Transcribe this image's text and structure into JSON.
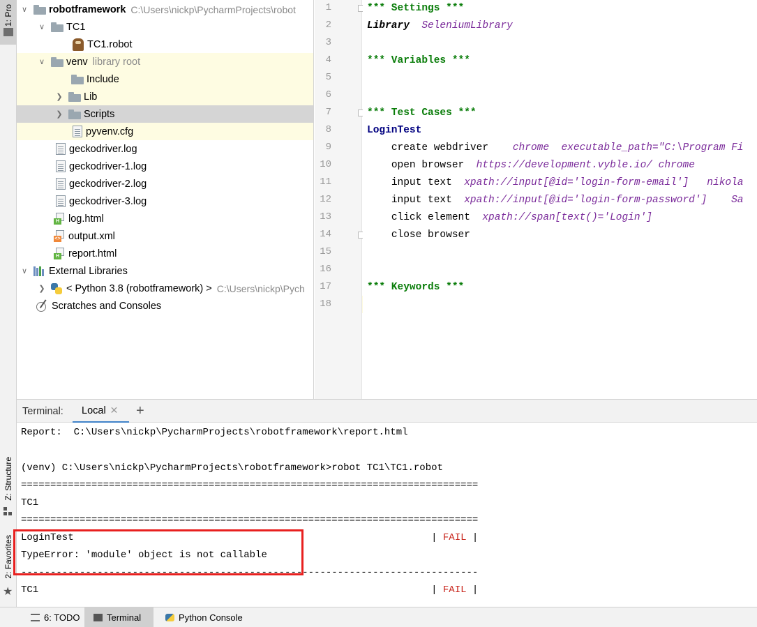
{
  "left_strip": {
    "tab_project": "1: Pro",
    "tab_structure": "Z: Structure",
    "tab_favorites": "2: Favorites"
  },
  "project_tree": [
    {
      "label": "robotframework",
      "meta": "C:\\Users\\nickp\\PycharmProjects\\robot"
    },
    {
      "label": "TC1"
    },
    {
      "label": "TC1.robot"
    },
    {
      "label": "venv",
      "meta": "library root"
    },
    {
      "label": "Include"
    },
    {
      "label": "Lib"
    },
    {
      "label": "Scripts"
    },
    {
      "label": "pyvenv.cfg"
    },
    {
      "label": "geckodriver.log"
    },
    {
      "label": "geckodriver-1.log"
    },
    {
      "label": "geckodriver-2.log"
    },
    {
      "label": "geckodriver-3.log"
    },
    {
      "label": "log.html"
    },
    {
      "label": "output.xml"
    },
    {
      "label": "report.html"
    },
    {
      "label": "External Libraries"
    },
    {
      "label": "< Python 3.8 (robotframework) >",
      "meta": "C:\\Users\\nickp\\Pych"
    },
    {
      "label": "Scratches and Consoles"
    }
  ],
  "editor": {
    "line_numbers": [
      "1",
      "2",
      "3",
      "4",
      "5",
      "6",
      "7",
      "8",
      "9",
      "10",
      "11",
      "12",
      "13",
      "14",
      "15",
      "16",
      "17",
      "18"
    ],
    "l1": "*** Settings ***",
    "l2_kw": "Library",
    "l2_arg": "SeleniumLibrary",
    "l4": "*** Variables ***",
    "l7": "*** Test Cases ***",
    "l8": "LoginTest",
    "l9_kw": "create webdriver",
    "l9_arg": "chrome  executable_path=\"C:\\Program Fi",
    "l10_kw": "open browser",
    "l10_arg": "https://development.vyble.io/ chrome",
    "l11_kw": "input text",
    "l11_arg": "xpath://input[@id='login-form-email']   nikola",
    "l12_kw": "input text",
    "l12_arg": "xpath://input[@id='login-form-password']    Sa",
    "l13_kw": "click element",
    "l13_arg": "xpath://span[text()='Login']",
    "l14_kw": "close browser",
    "l17": "*** Keywords ***"
  },
  "terminal": {
    "label": "Terminal:",
    "tab": "Local",
    "add": "+",
    "lines": {
      "report": "Report:  C:\\Users\\nickp\\PycharmProjects\\robotframework\\report.html",
      "command": "(venv) C:\\Users\\nickp\\PycharmProjects\\robotframework>robot TC1\\TC1.robot",
      "sep1": "==============================================================================",
      "tc1": "TC1",
      "sep2": "==============================================================================",
      "login_test": "LoginTest                                                             |",
      "fail1": "FAIL",
      "pipe": "|",
      "error": "TypeError: 'module' object is not callable",
      "sep3": "------------------------------------------------------------------------------",
      "tc1_result": "TC1                                                                   |",
      "fail2": "FAIL",
      "pipe2": "|"
    }
  },
  "bottom_bar": {
    "todo": "6: TODO",
    "terminal": "Terminal",
    "python_console": "Python Console"
  }
}
